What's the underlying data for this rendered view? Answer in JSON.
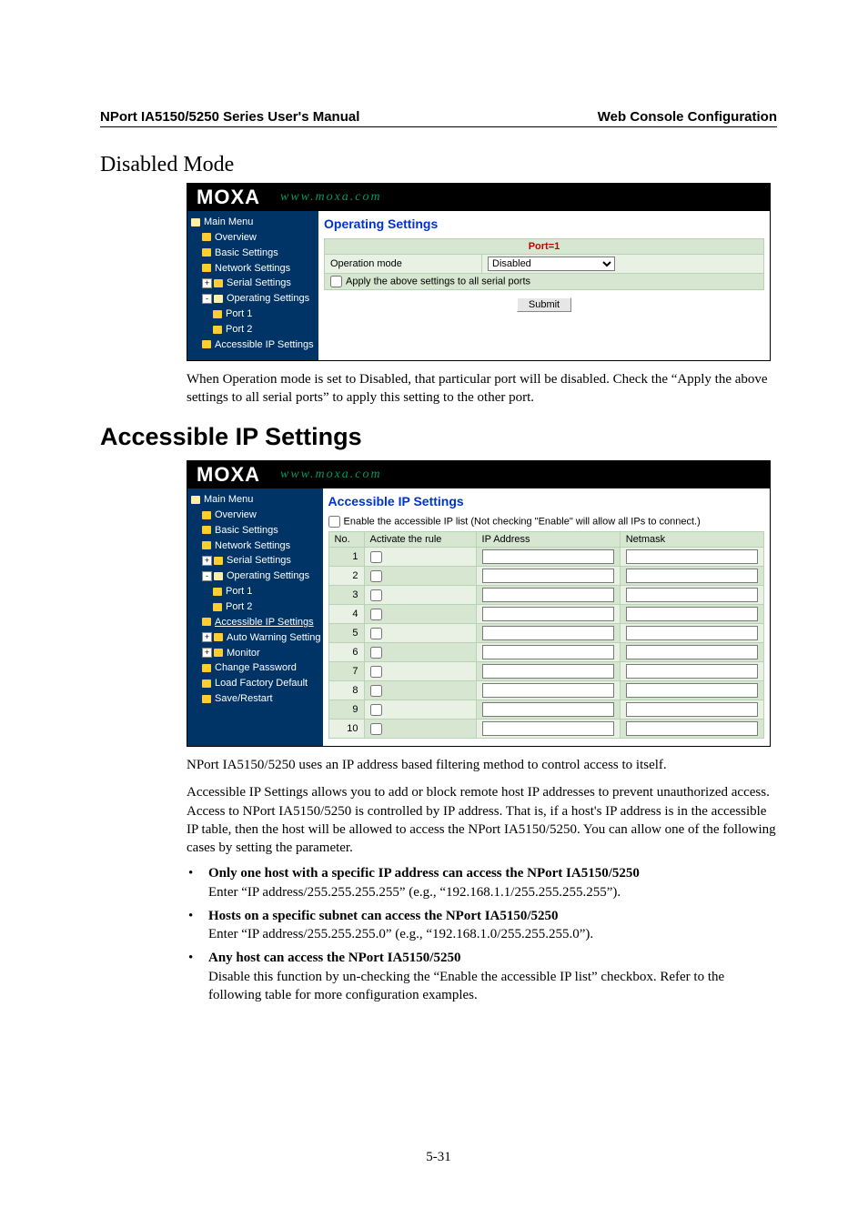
{
  "doc": {
    "header_left": "NPort IA5150/5250 Series User's Manual",
    "header_right": "Web Console Configuration",
    "h_disabled": "Disabled Mode",
    "h_accessible": "Accessible IP Settings",
    "p_disabled": "When Operation mode is set to Disabled, that particular port will be disabled. Check the “Apply the above settings to all serial ports” to apply this setting to the other port.",
    "p_access1": "NPort IA5150/5250 uses an IP address based filtering method to control access to itself.",
    "p_access2": "Accessible IP Settings allows you to add or block remote host IP addresses to prevent unauthorized access. Access to NPort IA5150/5250 is controlled by IP address. That is, if a host's IP address is in the accessible IP table, then the host will be allowed to access the NPort IA5150/5250. You can allow one of the following cases by setting the parameter.",
    "bullets": [
      {
        "bold": "Only one host with a specific IP address can access the NPort IA5150/5250",
        "text": "Enter “IP address/255.255.255.255” (e.g., “192.168.1.1/255.255.255.255”)."
      },
      {
        "bold": "Hosts on a specific subnet can access the NPort IA5150/5250",
        "text": "Enter “IP address/255.255.255.0” (e.g., “192.168.1.0/255.255.255.0”)."
      },
      {
        "bold": "Any host can access the NPort IA5150/5250",
        "text": "Disable this function by un-checking the “Enable the accessible IP list” checkbox. Refer to the following table for more configuration examples."
      }
    ],
    "page_num": "5-31"
  },
  "brand": {
    "name": "MOXA",
    "url": "www.moxa.com"
  },
  "shot1": {
    "title": "Operating Settings",
    "port_header": "Port=1",
    "row1_label": "Operation mode",
    "row1_value": "Disabled",
    "row2_label": "Apply the above settings to all serial ports",
    "submit": "Submit",
    "sidebar": {
      "root": "Main Menu",
      "items": [
        "Overview",
        "Basic Settings",
        "Network Settings",
        "Serial Settings",
        "Operating Settings",
        "Port 1",
        "Port 2",
        "Accessible IP Settings"
      ]
    }
  },
  "shot2": {
    "title": "Accessible IP Settings",
    "enable_label": "Enable the accessible IP list (Not checking \"Enable\" will allow all IPs to connect.)",
    "headers": {
      "no": "No.",
      "activate": "Activate the rule",
      "ip": "IP Address",
      "netmask": "Netmask"
    },
    "rows": [
      "1",
      "2",
      "3",
      "4",
      "5",
      "6",
      "7",
      "8",
      "9",
      "10"
    ],
    "sidebar": {
      "root": "Main Menu",
      "items": [
        "Overview",
        "Basic Settings",
        "Network Settings",
        "Serial Settings",
        "Operating Settings",
        "Port 1",
        "Port 2",
        "Accessible IP Settings",
        "Auto Warning Setting",
        "Monitor",
        "Change Password",
        "Load Factory Default",
        "Save/Restart"
      ]
    }
  }
}
